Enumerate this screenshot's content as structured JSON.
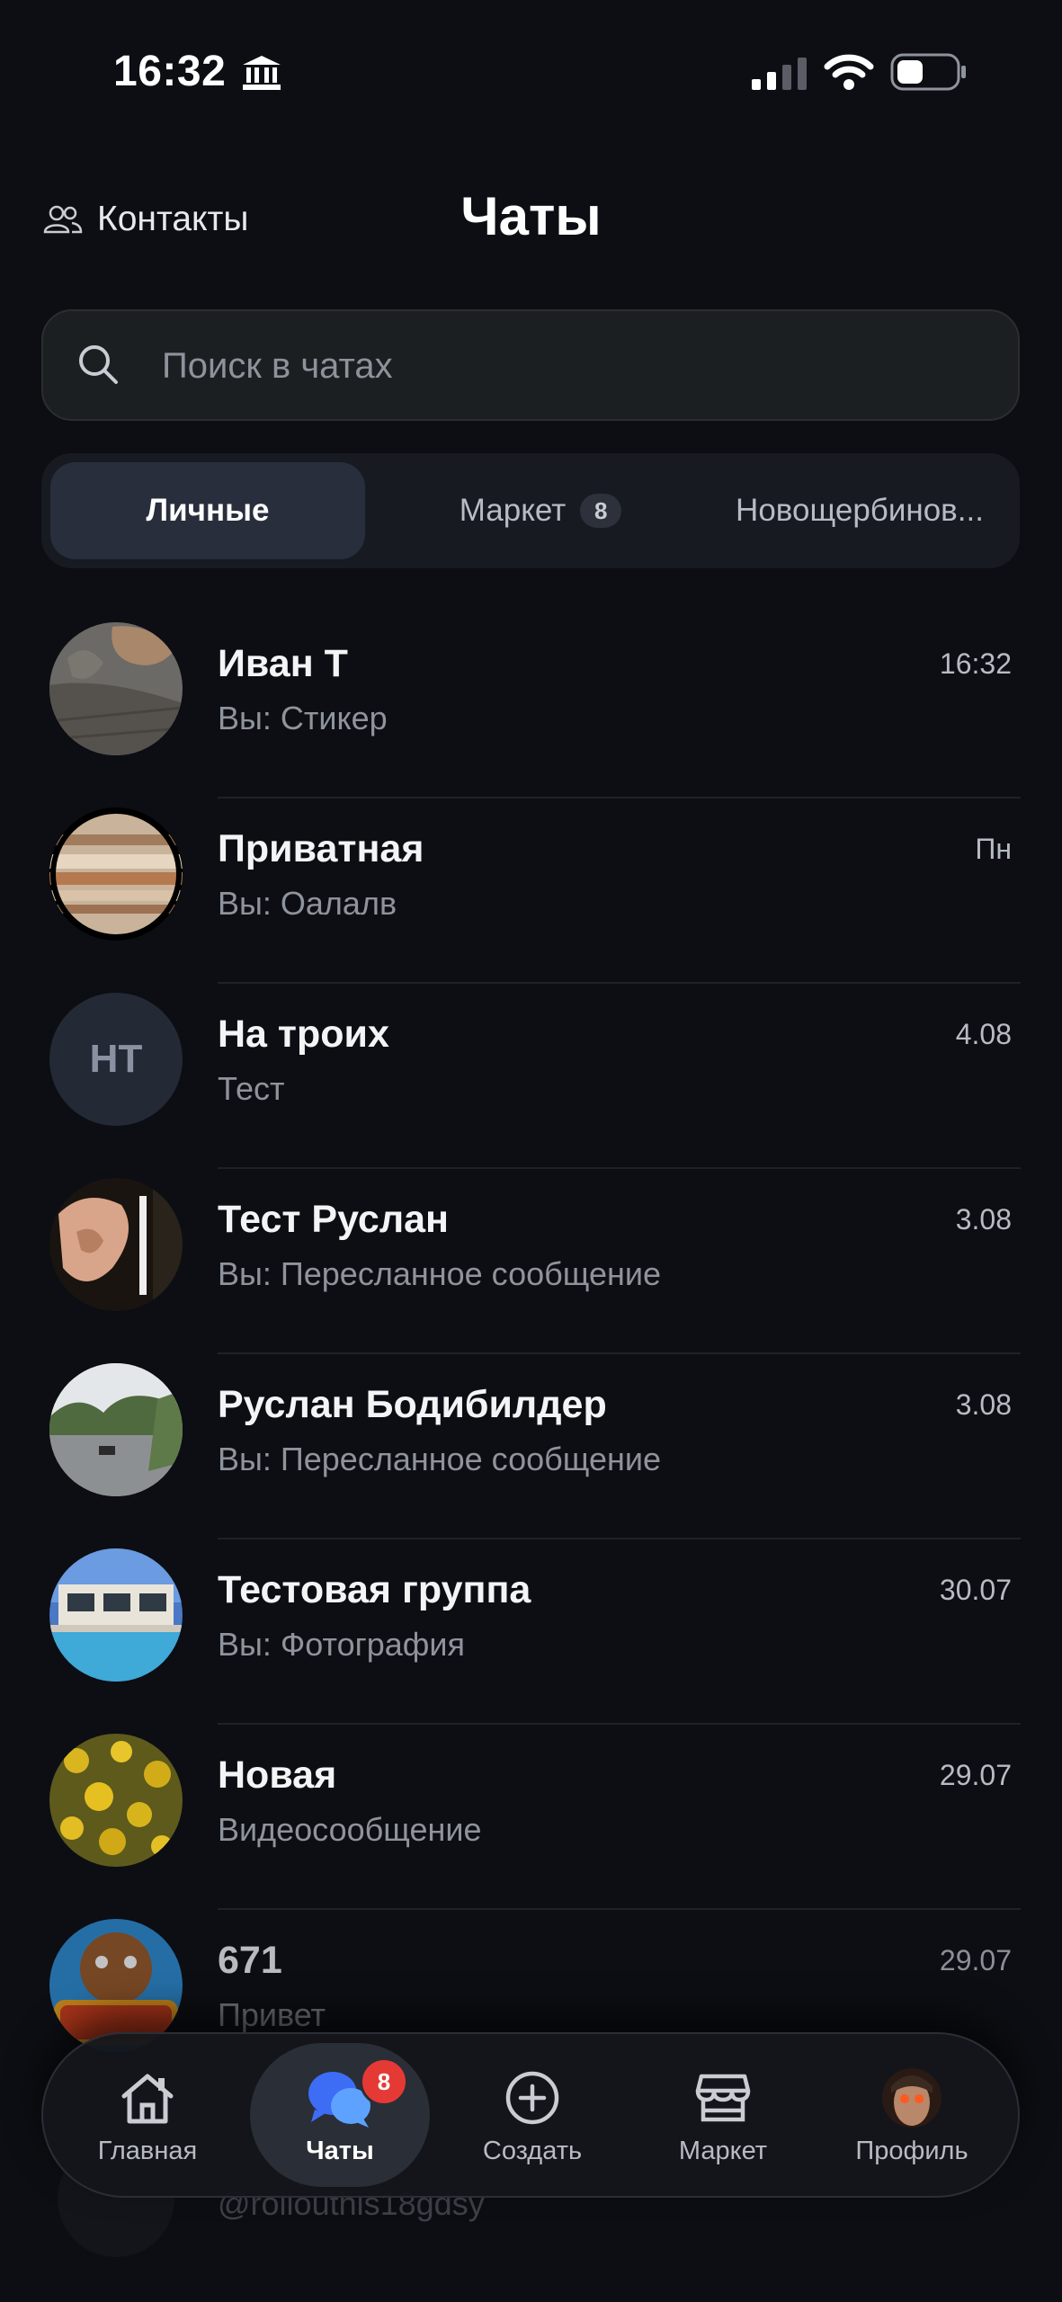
{
  "status_bar": {
    "time": "16:32"
  },
  "header": {
    "contacts_label": "Контакты",
    "title": "Чаты"
  },
  "search": {
    "placeholder": "Поиск в чатах",
    "value": ""
  },
  "tabs": [
    {
      "label": "Личные",
      "active": true
    },
    {
      "label": "Маркет",
      "badge": "8"
    },
    {
      "label": "Новощербинов..."
    }
  ],
  "chats": [
    {
      "name": "Иван Т",
      "preview": "Вы: Стикер",
      "time": "16:32"
    },
    {
      "name": "Приватная",
      "preview": "Вы: Оалалв",
      "time": "Пн"
    },
    {
      "name": "На троих",
      "preview": "Тест",
      "time": "4.08",
      "initials": "НТ"
    },
    {
      "name": "Тест Руслан",
      "preview": "Вы: Пересланное сообщение",
      "time": "3.08"
    },
    {
      "name": "Руслан Бодибилдер",
      "preview": "Вы: Пересланное сообщение",
      "time": "3.08"
    },
    {
      "name": "Тестовая группа",
      "preview": "Вы: Фотография",
      "time": "30.07"
    },
    {
      "name": "Новая",
      "preview": "Видеосообщение",
      "time": "29.07"
    },
    {
      "name": "671",
      "preview": "Привет",
      "time": "29.07"
    }
  ],
  "partial_row": {
    "preview": "@rollouthis18gdsy"
  },
  "bottom_nav": [
    {
      "label": "Главная",
      "icon": "home-icon"
    },
    {
      "label": "Чаты",
      "icon": "chats-icon",
      "active": true,
      "badge": "8"
    },
    {
      "label": "Создать",
      "icon": "plus-circle-icon"
    },
    {
      "label": "Маркет",
      "icon": "store-icon"
    },
    {
      "label": "Профиль",
      "icon": "profile-avatar"
    }
  ],
  "colors": {
    "background": "#0c0e13",
    "active_tab": "#282e3c",
    "badge": "#e53935"
  }
}
